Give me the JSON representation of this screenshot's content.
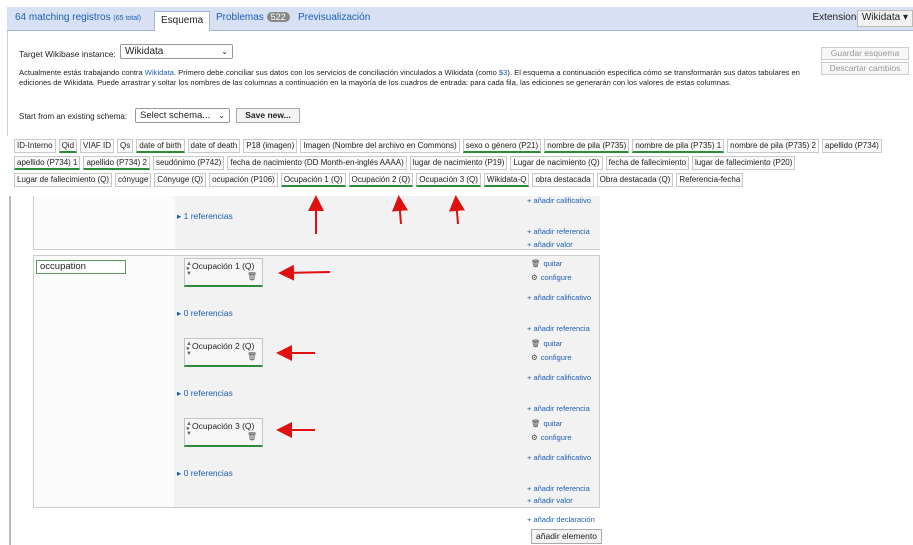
{
  "tabs": {
    "matching": "64 matching registros",
    "matching_total": "(65 total)",
    "schema": "Esquema",
    "problems": "Problemas",
    "problems_count": "522",
    "preview": "Previsualización",
    "extensions": "Extensiones",
    "extensions_btn": "Wikidata ▾"
  },
  "header": {
    "target_label": "Target Wikibase instance:",
    "target_value": "Wikidata",
    "desc_1": "Actualmente estás trabajando contra ",
    "desc_link_1": "Wikidata",
    "desc_2": ". Primero debe conciliar sus datos con los servicios de conciliación vinculados a Wikidata (como ",
    "desc_link_2": "$3",
    "desc_3": "). El esquema a continuación especifica cómo se transformarán sus datos tabulares en ediciones de Wikidata. Puede arrastrar y soltar los nombres de las columnas a continuación en la mayoría de los cuadros de entrada: para cada fila, las ediciones se generarán con los valores de estas columnas.",
    "save_schema": "Guardar esquema",
    "discard": "Descartar cambios",
    "start_label": "Start from an existing schema:",
    "schema_select": "Select schema...",
    "save_new": "Save new..."
  },
  "columns": {
    "row1": [
      {
        "label": "ID-Interno",
        "matched": false
      },
      {
        "label": "Qid",
        "matched": true
      },
      {
        "label": "VIAF ID",
        "matched": false
      },
      {
        "label": "Qs",
        "matched": false
      },
      {
        "label": "date of birth",
        "matched": true
      },
      {
        "label": "date of death",
        "matched": false
      },
      {
        "label": "P18 (imagen)",
        "matched": false
      },
      {
        "label": "Imagen (Nombre del archivo en Commons)",
        "matched": false
      },
      {
        "label": "sexo o género (P21)",
        "matched": true
      },
      {
        "label": "nombre de pila (P735)",
        "matched": true
      },
      {
        "label": "nombre de pila (P735) 1",
        "matched": true
      },
      {
        "label": "nombre de pila (P735) 2",
        "matched": false
      },
      {
        "label": "apellido (P734)",
        "matched": false
      }
    ],
    "row2": [
      {
        "label": "apellido (P734) 1",
        "matched": true
      },
      {
        "label": "apellido (P734) 2",
        "matched": true
      },
      {
        "label": "seudónimo (P742)",
        "matched": false
      },
      {
        "label": "fecha de nacimiento (DD Month-en-inglés AAAA)",
        "matched": false
      },
      {
        "label": "lugar de nacimiento (P19)",
        "matched": false
      },
      {
        "label": "Lugar de nacimiento (Q)",
        "matched": false
      },
      {
        "label": "fecha de fallecimiento",
        "matched": false
      },
      {
        "label": "lugar de fallecimiento (P20)",
        "matched": false
      }
    ],
    "row3": [
      {
        "label": "Lugar de fallecimiento (Q)",
        "matched": false
      },
      {
        "label": "cónyuge",
        "matched": false
      },
      {
        "label": "Cónyuge (Q)",
        "matched": false
      },
      {
        "label": "ocupación (P106)",
        "matched": false
      },
      {
        "label": "Ocupación 1 (Q)",
        "matched": true
      },
      {
        "label": "Ocupación 2 (Q)",
        "matched": true
      },
      {
        "label": "Ocupación 3 (Q)",
        "matched": true
      },
      {
        "label": "Wikidata-Q",
        "matched": true
      },
      {
        "label": "obra destacada",
        "matched": false
      },
      {
        "label": "Obra destacada (Q)",
        "matched": false
      },
      {
        "label": "Referencia-fecha",
        "matched": false
      }
    ]
  },
  "editor": {
    "top_add_qualifier": "+ añadir calificativo",
    "top_refs": "1 referencias",
    "top_add_reference": "+ añadir referencia",
    "top_add_value": "+ añadir valor",
    "property": "occupation",
    "values": [
      {
        "label": "Ocupación 1 (Q)",
        "refs": "0 referencias"
      },
      {
        "label": "Ocupación 2 (Q)",
        "refs": "0 referencias"
      },
      {
        "label": "Ocupación 3 (Q)",
        "refs": "0 referencias"
      }
    ],
    "remove": "quitar",
    "configure": "configure",
    "add_qualifier": "+ añadir calificativo",
    "add_reference": "+ añadir referencia",
    "add_value": "+ añadir valor",
    "add_statement": "+ añadir declaración",
    "add_item": "añadir elemento"
  }
}
